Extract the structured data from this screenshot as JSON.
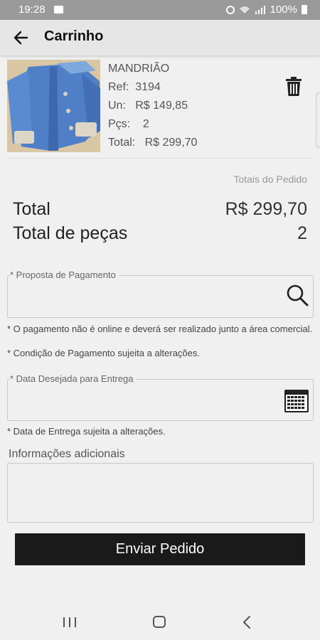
{
  "status_bar": {
    "time": "19:28",
    "battery": "100%"
  },
  "app_bar": {
    "title": "Carrinho"
  },
  "product": {
    "name": "MANDRIÃO",
    "ref_label": "Ref:",
    "ref_value": "3194",
    "unit_label": "Un:",
    "unit_value": "R$ 149,85",
    "qty_label": "Pçs:",
    "qty_value": "2",
    "total_label": "Total:",
    "total_value": "R$ 299,70"
  },
  "totals": {
    "caption": "Totais do Pedido",
    "total_label": "Total",
    "total_value": "R$ 299,70",
    "pieces_label": "Total de peças",
    "pieces_value": "2"
  },
  "payment": {
    "label": "* Proposta de Pagamento",
    "note1": "* O pagamento não é online e deverá ser realizado junto a área comercial.",
    "note2": "* Condição de Pagamento sujeita a alterações."
  },
  "delivery": {
    "label": "* Data Desejada para Entrega",
    "note": "* Data de Entrega sujeita a alterações."
  },
  "additional": {
    "label": "Informações adicionais"
  },
  "submit_label": "Enviar Pedido"
}
